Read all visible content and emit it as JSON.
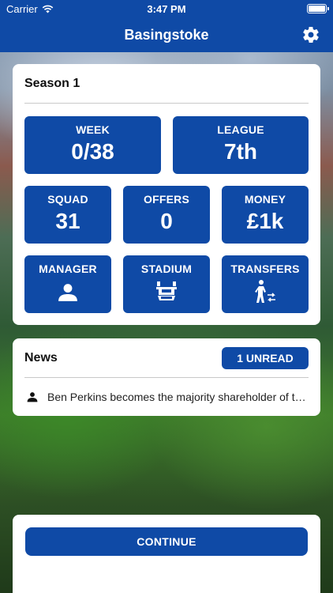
{
  "status_bar": {
    "carrier": "Carrier",
    "time": "3:47 PM"
  },
  "nav": {
    "title": "Basingstoke",
    "settings_icon": "gear-icon"
  },
  "season": {
    "title": "Season 1",
    "tiles": {
      "week": {
        "label": "WEEK",
        "value": "0/38"
      },
      "league": {
        "label": "LEAGUE",
        "value": "7th"
      },
      "squad": {
        "label": "SQUAD",
        "value": "31"
      },
      "offers": {
        "label": "OFFERS",
        "value": "0"
      },
      "money": {
        "label": "MONEY",
        "value": "£1k"
      },
      "manager": {
        "label": "MANAGER",
        "icon": "person-icon"
      },
      "stadium": {
        "label": "STADIUM",
        "icon": "stadium-icon"
      },
      "transfers": {
        "label": "TRANSFERS",
        "icon": "transfer-icon"
      }
    }
  },
  "news": {
    "title": "News",
    "unread_label": "1 UNREAD",
    "items": [
      {
        "icon": "person-icon",
        "text": "Ben Perkins becomes the majority shareholder of the club"
      }
    ]
  },
  "continue_label": "CONTINUE",
  "colors": {
    "brand_blue": "#0f4aa6",
    "card_bg": "#ffffff"
  }
}
